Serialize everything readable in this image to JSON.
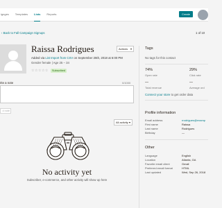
{
  "nav": {
    "items": [
      "ignges",
      "Templates",
      "Lists",
      "Reports"
    ],
    "active_index": 2,
    "create_label": "Create"
  },
  "breadcrumb": {
    "back_label": "Back to Fall Campaign Signups",
    "pager": "1 of 10"
  },
  "contact": {
    "name": "Raissa Rodrigues",
    "actions_label": "Actions",
    "added_prefix": "Added via",
    "added_source": "List Import from CSV",
    "added_suffix": "on September 25th, 2018 at 6:00 PM",
    "meta": "Gender female | Age 25 – 34",
    "stars": "☆☆☆☆☆",
    "rating": 0,
    "status_badge": "Subscribed"
  },
  "note": {
    "label": "rite a note",
    "counter": "0/1000",
    "add_button": "d note"
  },
  "activity": {
    "filter_label": "All activity",
    "empty_title": "No activity yet",
    "empty_subtitle": "Subscriber, e-commerce, and other activity will show up here"
  },
  "tags": {
    "heading": "Tags",
    "empty_text": "No tags for this contact"
  },
  "stats": {
    "open_rate_value": "74%",
    "open_rate_label": "Open rate",
    "click_rate_value": "29%",
    "click_rate_label": "Click rate",
    "total_revenue_value": "—",
    "total_revenue_label": "Total revenue",
    "avg_order_value": "—",
    "avg_order_label": "Average ord",
    "connect_link": "Connect your store",
    "connect_suffix": "to get order data"
  },
  "profile": {
    "heading": "Profile information",
    "rows": [
      {
        "key": "Email address",
        "value": "rrodrigues@examp"
      },
      {
        "key": "First name",
        "value": "Raissa"
      },
      {
        "key": "Last name",
        "value": "Rodrigues"
      },
      {
        "key": "Birthday",
        "value": "—"
      }
    ]
  },
  "other": {
    "heading": "Other",
    "rows": [
      {
        "key": "Language",
        "value": "English"
      },
      {
        "key": "Location",
        "value": "Atlanta, GA"
      },
      {
        "key": "Favorite email client",
        "value": "Gmail"
      },
      {
        "key": "Preferred email format",
        "value": "HTML"
      },
      {
        "key": "Last updated",
        "value": "Wed, Sep 26, 2018"
      }
    ]
  },
  "colors": {
    "accent": "#007c89",
    "badge_bg": "#d6efc9",
    "background": "#f4f4f4"
  }
}
